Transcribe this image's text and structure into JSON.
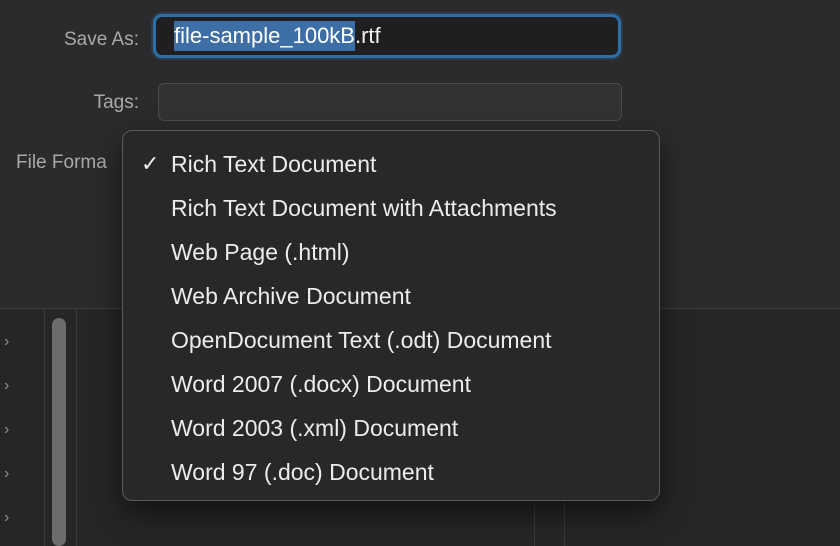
{
  "save_as": {
    "label": "Save As:",
    "filename_selected": "file-sample_100kB",
    "filename_extension": ".rtf"
  },
  "tags": {
    "label": "Tags:",
    "value": ""
  },
  "file_format": {
    "label": "File Forma",
    "selected_index": 0,
    "options": [
      {
        "label": "Rich Text Document",
        "checked": true
      },
      {
        "label": "Rich Text Document with Attachments",
        "checked": false
      },
      {
        "label": "Web Page (.html)",
        "checked": false
      },
      {
        "label": "Web Archive Document",
        "checked": false
      },
      {
        "label": "OpenDocument Text (.odt) Document",
        "checked": false
      },
      {
        "label": "Word 2007 (.docx) Document",
        "checked": false
      },
      {
        "label": "Word 2003 (.xml) Document",
        "checked": false
      },
      {
        "label": "Word 97 (.doc) Document",
        "checked": false
      }
    ],
    "check_glyph": "✓"
  },
  "sidebar": {
    "chevron_glyph": "›"
  },
  "colors": {
    "selection": "#3d6fa6",
    "focus_ring": "#2f6fa8",
    "background": "#2b2b2d"
  }
}
